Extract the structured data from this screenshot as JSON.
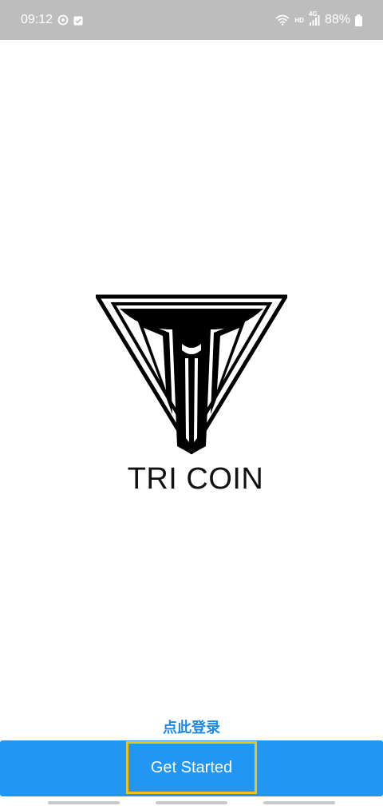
{
  "status_bar": {
    "time": "09:12",
    "battery": "88%",
    "network": "4G",
    "hd": "HD"
  },
  "logo": {
    "brand_text": "TRI COIN",
    "icon": "tri-coin-logo-icon"
  },
  "actions": {
    "login_link": "点此登录",
    "get_started_label": "Get Started"
  },
  "colors": {
    "primary": "#2196f3",
    "link": "#1e88e5",
    "highlight": "#f4c20d",
    "status_bar": "#bdbdbd"
  }
}
